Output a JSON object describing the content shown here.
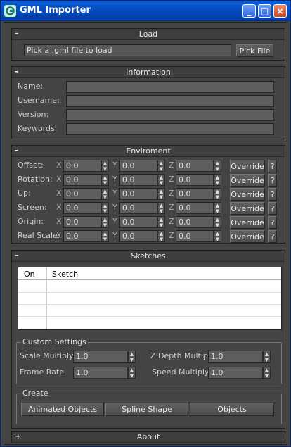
{
  "window": {
    "title": "GML Importer",
    "minimize": "_",
    "maximize": "□",
    "close": "×"
  },
  "load": {
    "header": "Load",
    "toggle": "–",
    "file_field": "Pick a .gml file to load",
    "pick_button": "Pick File"
  },
  "information": {
    "header": "Information",
    "toggle": "–",
    "labels": [
      "Name:",
      "Username:",
      "Version:",
      "Keywords:"
    ]
  },
  "environment": {
    "header": "Enviroment",
    "toggle": "–",
    "rows": [
      {
        "label": "Offset:",
        "x": "0.0",
        "y": "0.0",
        "z": "0.0"
      },
      {
        "label": "Rotation:",
        "x": "0.0",
        "y": "0.0",
        "z": "0.0"
      },
      {
        "label": "Up:",
        "x": "0.0",
        "y": "0.0",
        "z": "0.0"
      },
      {
        "label": "Screen:",
        "x": "0.0",
        "y": "0.0",
        "z": "0.0"
      },
      {
        "label": "Origin:",
        "x": "0.0",
        "y": "0.0",
        "z": "0.0"
      },
      {
        "label": "Real Scale:",
        "x": "0.0",
        "y": "0.0",
        "z": "0.0"
      }
    ],
    "axis_x": "X",
    "axis_y": "Y",
    "axis_z": "Z",
    "override_label": "Override",
    "help_label": "?"
  },
  "sketches": {
    "header": "Sketches",
    "toggle": "–",
    "columns": [
      "On",
      "Sketch"
    ],
    "custom_settings": {
      "title": "Custom Settings",
      "scale_label": "Scale Multiplyer",
      "scale_value": "1.0",
      "zdepth_label": "Z Depth Multipler",
      "zdepth_value": "1.0",
      "framerate_label": "Frame Rate",
      "framerate_value": "1.0",
      "speed_label": "Speed Multiplyer",
      "speed_value": "1.0"
    },
    "create": {
      "title": "Create",
      "animated": "Animated Objects",
      "spline": "Spline Shape",
      "objects": "Objects"
    }
  },
  "about": {
    "header": "About",
    "toggle": "+"
  }
}
